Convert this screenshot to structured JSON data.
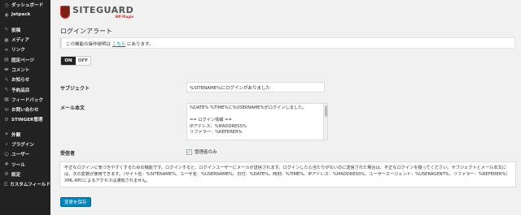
{
  "sidebar": {
    "items": [
      {
        "label": "ダッシュボード",
        "icon": "dashboard-icon"
      },
      {
        "label": "Jetpack",
        "icon": "jetpack-icon"
      },
      {
        "sep": true
      },
      {
        "label": "投稿",
        "icon": "pin-icon"
      },
      {
        "label": "メディア",
        "icon": "media-icon"
      },
      {
        "label": "リンク",
        "icon": "link-icon"
      },
      {
        "label": "固定ページ",
        "icon": "page-icon"
      },
      {
        "label": "コメント",
        "icon": "comment-icon"
      },
      {
        "label": "お知らせ",
        "icon": "pin-icon"
      },
      {
        "label": "予約品目",
        "icon": "pin-icon"
      },
      {
        "label": "フィードバック",
        "icon": "feedback-icon"
      },
      {
        "label": "お問い合わせ",
        "icon": "mail-icon"
      },
      {
        "label": "STINGER管理",
        "icon": "settings-icon"
      },
      {
        "sep": true
      },
      {
        "label": "外観",
        "icon": "appearance-icon"
      },
      {
        "label": "プラグイン",
        "icon": "plugin-icon"
      },
      {
        "label": "ユーザー",
        "icon": "user-icon"
      },
      {
        "label": "ツール",
        "icon": "tool-icon"
      },
      {
        "label": "設定",
        "icon": "settings-icon"
      },
      {
        "label": "カスタムフィールド",
        "icon": "field-icon"
      }
    ]
  },
  "logo": {
    "text": "SITEGUARD",
    "sub": "WP Plugin"
  },
  "page": {
    "title": "ログインアラート",
    "notice_pre": "この機能の操作説明は ",
    "notice_link": "こちら",
    "notice_post": " にあります。"
  },
  "toggle": {
    "on": "ON",
    "off": "OFF"
  },
  "form": {
    "subject_label": "サブジェクト",
    "subject_value": "%SITENAME%にログインがありました",
    "body_label": "メール本文",
    "body_lines": [
      "%DATE% %TIME%に%USERNAME%がログインしました。",
      "",
      "== ログイン情報 ==",
      "IPアドレス：%IPADDRESS%",
      "リファラー：%REFERER%"
    ],
    "recv_label": "受信者",
    "recv_option": "管理者のみ",
    "description": "不正なログインに気づきやすくするための機能です。ログインすると、ログインユーザーにメールが送信されます。ログインした心当たりがないのに送信された場合は、不正なログインを疑ってください。サブジェクトとメール本文には、次の変数が使用できます。（サイト名：%SITENAME%、ユーザ名：%USERNAME%、日付：%DATE%、時刻：%TIME%、IPアドレス：%IPADDRESS%、ユーザーエージェント：%USERAGENT%、リファラー：%REFERER%）XML-RPCによるアクセスは通知されません。",
    "save_label": "変更を保存"
  }
}
